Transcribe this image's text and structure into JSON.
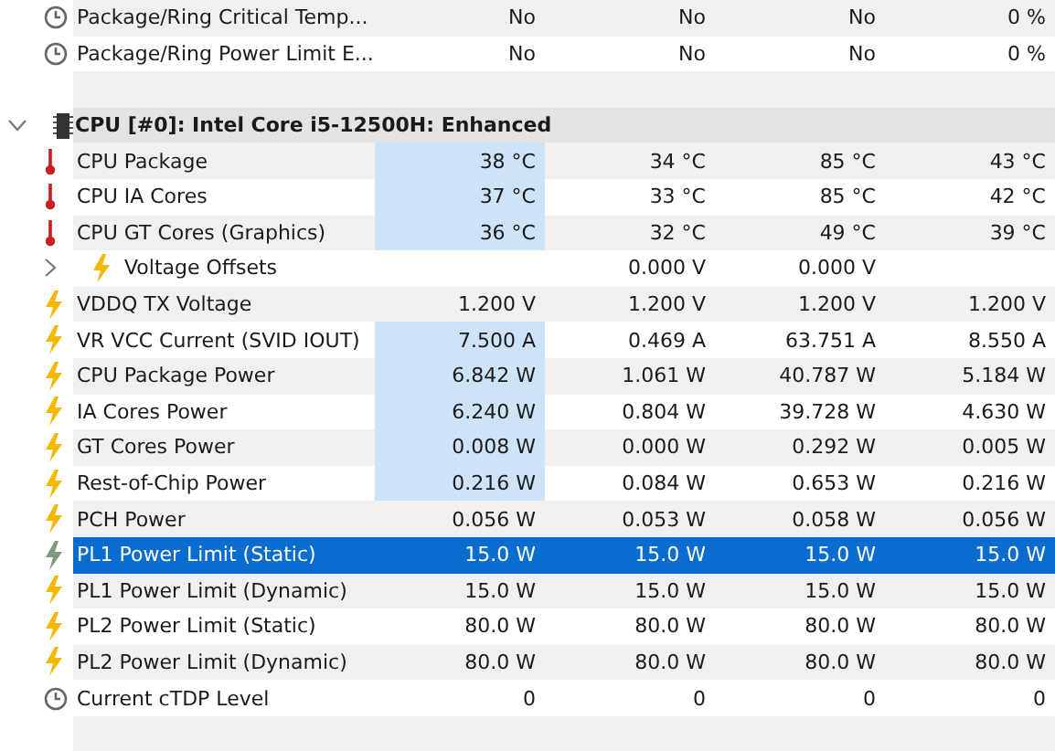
{
  "rows": [
    {
      "kind": "clock",
      "label": "Package/Ring Critical Temp...",
      "values": [
        "No",
        "No",
        "No",
        "0 %"
      ],
      "highlighted": false,
      "selected": false
    },
    {
      "kind": "clock",
      "label": "Package/Ring Power Limit E...",
      "values": [
        "No",
        "No",
        "No",
        "0 %"
      ],
      "highlighted": false,
      "selected": false
    },
    {
      "kind": "spacer"
    },
    {
      "kind": "group",
      "label": "CPU [#0]: Intel Core i5-12500H: Enhanced",
      "expanded": true
    },
    {
      "kind": "thermometer",
      "label": "CPU Package",
      "values": [
        "38 °C",
        "34 °C",
        "85 °C",
        "43 °C"
      ],
      "highlighted": true,
      "selected": false
    },
    {
      "kind": "thermometer",
      "label": "CPU IA Cores",
      "values": [
        "37 °C",
        "33 °C",
        "85 °C",
        "42 °C"
      ],
      "highlighted": true,
      "selected": false
    },
    {
      "kind": "thermometer",
      "label": "CPU GT Cores (Graphics)",
      "values": [
        "36 °C",
        "32 °C",
        "49 °C",
        "39 °C"
      ],
      "highlighted": true,
      "selected": false
    },
    {
      "kind": "subgroup",
      "label": "Voltage Offsets",
      "column_2": "0.000 V",
      "column_3": "0.000 V",
      "expanded": false
    },
    {
      "kind": "bolt",
      "label": "VDDQ TX Voltage",
      "values": [
        "1.200 V",
        "1.200 V",
        "1.200 V",
        "1.200 V"
      ],
      "highlighted": false,
      "selected": false
    },
    {
      "kind": "bolt",
      "label": "VR VCC Current (SVID IOUT)",
      "values": [
        "7.500 A",
        "0.469 A",
        "63.751 A",
        "8.550 A"
      ],
      "highlighted": true,
      "selected": false
    },
    {
      "kind": "bolt",
      "label": "CPU Package Power",
      "values": [
        "6.842 W",
        "1.061 W",
        "40.787 W",
        "5.184 W"
      ],
      "highlighted": true,
      "selected": false
    },
    {
      "kind": "bolt",
      "label": "IA Cores Power",
      "values": [
        "6.240 W",
        "0.804 W",
        "39.728 W",
        "4.630 W"
      ],
      "highlighted": true,
      "selected": false
    },
    {
      "kind": "bolt",
      "label": "GT Cores Power",
      "values": [
        "0.008 W",
        "0.000 W",
        "0.292 W",
        "0.005 W"
      ],
      "highlighted": true,
      "selected": false
    },
    {
      "kind": "bolt",
      "label": "Rest-of-Chip Power",
      "values": [
        "0.216 W",
        "0.084 W",
        "0.653 W",
        "0.216 W"
      ],
      "highlighted": true,
      "selected": false
    },
    {
      "kind": "bolt",
      "label": "PCH Power",
      "values": [
        "0.056 W",
        "0.053 W",
        "0.058 W",
        "0.056 W"
      ],
      "highlighted": false,
      "selected": false
    },
    {
      "kind": "bolt",
      "label": "PL1 Power Limit (Static)",
      "values": [
        "15.0 W",
        "15.0 W",
        "15.0 W",
        "15.0 W"
      ],
      "highlighted": false,
      "selected": true
    },
    {
      "kind": "bolt",
      "label": "PL1 Power Limit (Dynamic)",
      "values": [
        "15.0 W",
        "15.0 W",
        "15.0 W",
        "15.0 W"
      ],
      "highlighted": false,
      "selected": false
    },
    {
      "kind": "bolt",
      "label": "PL2 Power Limit (Static)",
      "values": [
        "80.0 W",
        "80.0 W",
        "80.0 W",
        "80.0 W"
      ],
      "highlighted": false,
      "selected": false
    },
    {
      "kind": "bolt",
      "label": "PL2 Power Limit (Dynamic)",
      "values": [
        "80.0 W",
        "80.0 W",
        "80.0 W",
        "80.0 W"
      ],
      "highlighted": false,
      "selected": false
    },
    {
      "kind": "clock",
      "label": "Current cTDP Level",
      "values": [
        "0",
        "0",
        "0",
        "0"
      ],
      "highlighted": false,
      "selected": false
    },
    {
      "kind": "spacer"
    }
  ]
}
